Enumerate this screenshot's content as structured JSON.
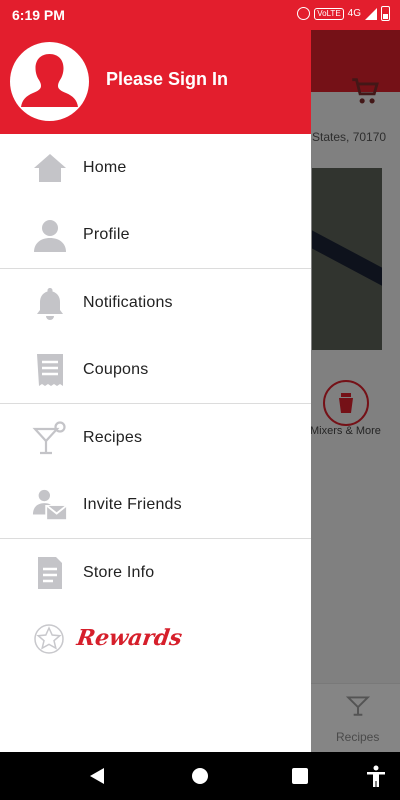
{
  "status_bar": {
    "time": "6:19 PM",
    "volte": "VoLTE",
    "network": "4G"
  },
  "drawer": {
    "sign_in_label": "Please Sign In",
    "items": [
      {
        "label": "Home",
        "icon": "home-icon"
      },
      {
        "label": "Profile",
        "icon": "person-icon"
      },
      {
        "label": "Notifications",
        "icon": "bell-icon"
      },
      {
        "label": "Coupons",
        "icon": "receipt-icon"
      },
      {
        "label": "Recipes",
        "icon": "cocktail-icon"
      },
      {
        "label": "Invite Friends",
        "icon": "invite-icon"
      },
      {
        "label": "Store Info",
        "icon": "document-icon"
      }
    ],
    "rewards_label": "Rewards"
  },
  "background": {
    "address_fragment": "States, 70170",
    "category_label": "Mixers & More",
    "bottom_tab_label": "Recipes"
  },
  "colors": {
    "brand_red": "#e31e2d",
    "icon_gray": "#c4c4c8"
  }
}
